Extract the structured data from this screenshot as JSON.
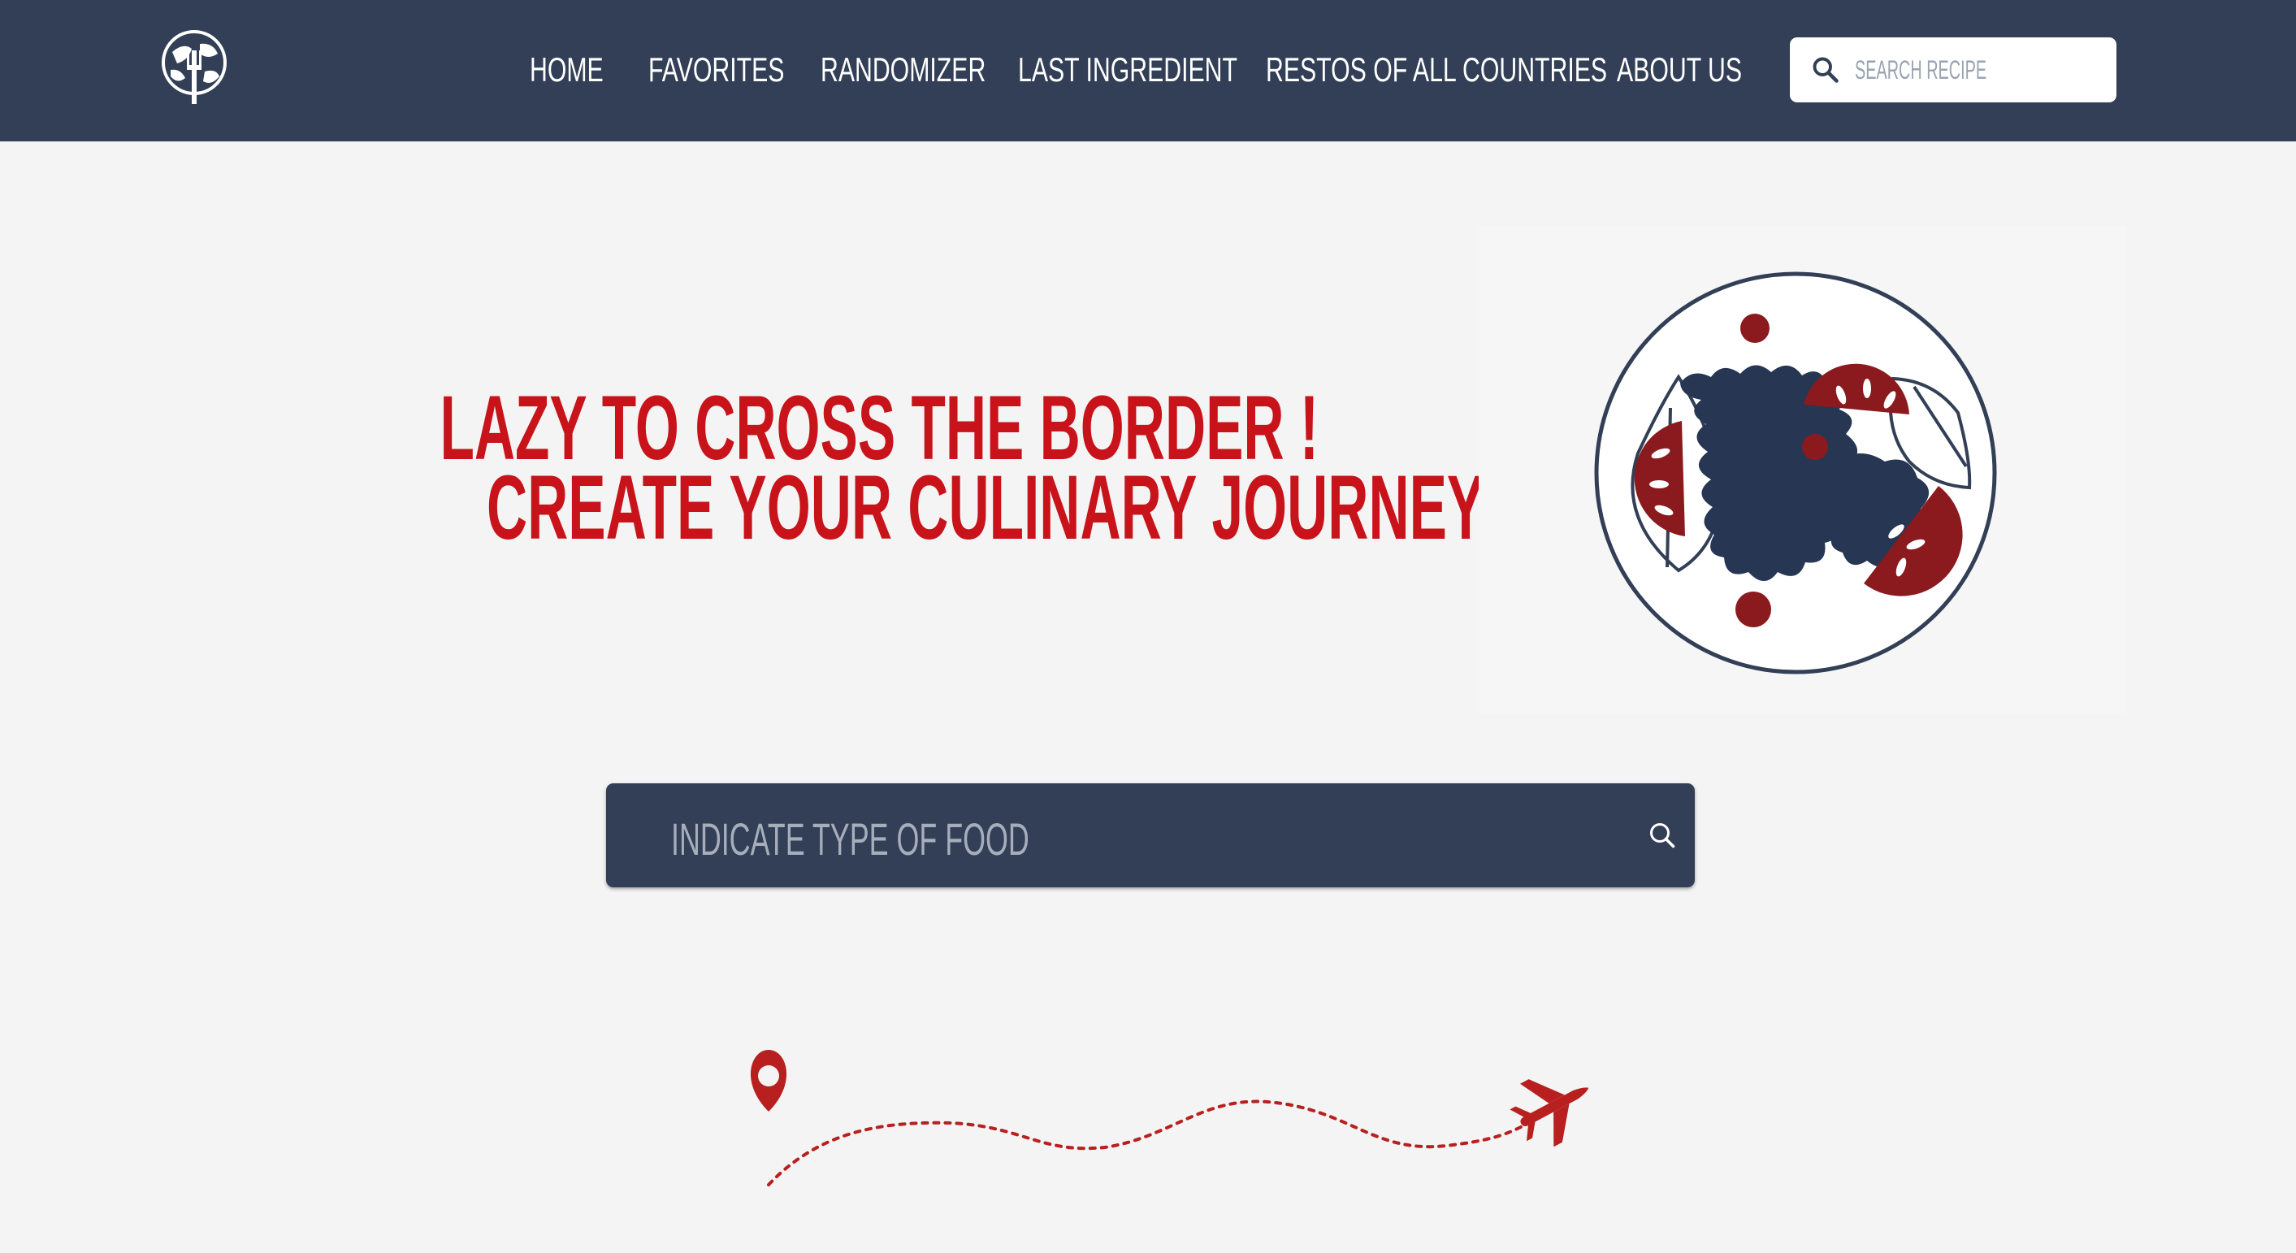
{
  "nav": {
    "items": [
      {
        "label": "HOME"
      },
      {
        "label": "FAVORITES"
      },
      {
        "label": "RANDOMIZER"
      },
      {
        "label": "LAST INGREDIENT"
      },
      {
        "label": "RESTOS OF ALL COUNTRIES"
      },
      {
        "label": "ABOUT US"
      }
    ],
    "search_placeholder": "SEARCH RECIPE"
  },
  "hero": {
    "line1": "LAZY TO CROSS THE BORDER !",
    "line2": "CREATE YOUR CULINARY JOURNEY !"
  },
  "food_search": {
    "placeholder": "INDICATE TYPE OF FOOD"
  },
  "icons": {
    "logo": "globe-fork-logo-icon",
    "nav_search": "search-icon",
    "food_search": "search-icon",
    "plate": "salad-plate-illustration",
    "pin": "location-pin-icon",
    "plane": "airplane-icon"
  },
  "colors": {
    "navy": "#323f56",
    "red": "#c8131b",
    "tomato": "#8b1a1e",
    "background": "#f4f4f4"
  }
}
